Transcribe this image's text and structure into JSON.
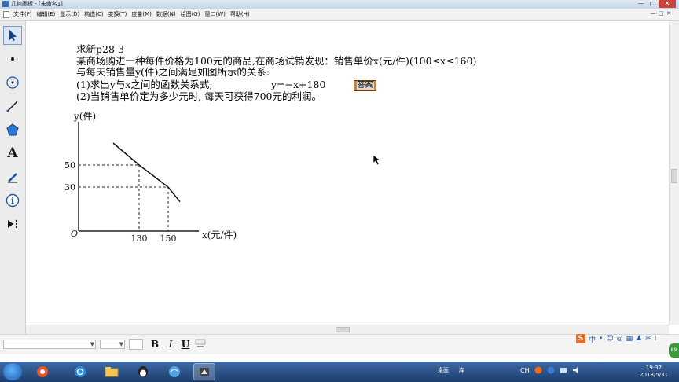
{
  "window": {
    "title": "几何画板 - [未命名1]",
    "buttons": [
      "—",
      "□",
      "✕"
    ]
  },
  "menubar": {
    "items": [
      "文件(F)",
      "编辑(E)",
      "显示(D)",
      "构造(C)",
      "变换(T)",
      "度量(M)",
      "数据(N)",
      "绘图(G)",
      "窗口(W)",
      "帮助(H)"
    ],
    "mdi_buttons": [
      "—",
      "□",
      "✕"
    ]
  },
  "toolbox": {
    "tools": [
      "arrow-select-tool",
      "point-tool",
      "compass-tool",
      "straightedge-tool",
      "polygon-tool",
      "text-tool",
      "marker-tool",
      "information-tool",
      "custom-tool"
    ],
    "text_tool_glyph": "A",
    "info_tool_glyph": "i"
  },
  "problem": {
    "title": "求新p28-3",
    "line1": "某商场购进一种每件价格为100元的商品,在商场试销发现：销售单价x(元/件)(100≤x≤160)",
    "line2": "与每天销售量y(件)之间满足如图所示的关系:",
    "q1": "(1)求出y与x之间的函数关系式;",
    "q1_answer": "y=−x+180",
    "answer_button": "答案",
    "q2": "(2)当销售单价定为多少元时, 每天可获得700元的利润。"
  },
  "chart_data": {
    "type": "line",
    "xlabel": "x(元/件)",
    "ylabel": "y(件)",
    "origin_label": "O",
    "x_ticks": [
      "130",
      "150"
    ],
    "y_ticks": [
      "50",
      "30"
    ],
    "series": [
      {
        "x": [
          100,
          130,
          150,
          160
        ],
        "y": [
          80,
          50,
          30,
          20
        ]
      }
    ],
    "dashed_points": [
      {
        "x": 130,
        "y": 50
      },
      {
        "x": 150,
        "y": 30
      }
    ]
  },
  "textbar": {
    "bold": "B",
    "italic": "I",
    "underline": "U"
  },
  "ime": {
    "logo": "S",
    "items": [
      "中",
      "•",
      "☺",
      "◎",
      "▦",
      "♟",
      "✂",
      "⁞"
    ]
  },
  "tray_badge": "69",
  "taskbar": {
    "desktop_label": "桌面",
    "library_label": "库",
    "tray_lang": "CH",
    "time": "19:37",
    "date": "2018/5/31"
  },
  "colors": {
    "answer_button_bg": "#c7823e",
    "tool_icon": "#1b55a5",
    "taskbar": "#1c3d6e"
  }
}
